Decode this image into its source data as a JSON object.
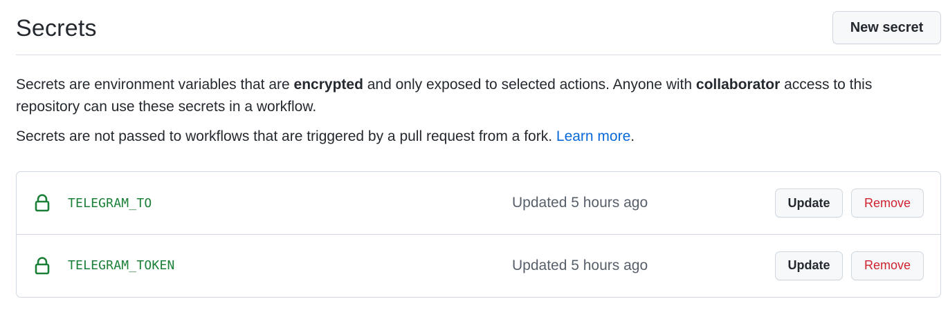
{
  "header": {
    "title": "Secrets",
    "new_secret_label": "New secret"
  },
  "description": {
    "p1_a": "Secrets are environment variables that are ",
    "p1_b": "encrypted",
    "p1_c": " and only exposed to selected actions. Anyone with ",
    "p1_d": "collaborator",
    "p1_e": " access to this repository can use these secrets in a workflow.",
    "p2_a": "Secrets are not passed to workflows that are triggered by a pull request from a fork. ",
    "p2_link": "Learn more",
    "p2_end": "."
  },
  "secrets": [
    {
      "name": "TELEGRAM_TO",
      "updated": "Updated 5 hours ago",
      "update_label": "Update",
      "remove_label": "Remove",
      "icon": "lock-icon"
    },
    {
      "name": "TELEGRAM_TOKEN",
      "updated": "Updated 5 hours ago",
      "update_label": "Update",
      "remove_label": "Remove",
      "icon": "lock-icon"
    }
  ],
  "colors": {
    "secret_name": "#1a7f37",
    "lock_icon": "#1a7f37",
    "link": "#0969da",
    "danger": "#cf222e",
    "muted": "#57606a"
  }
}
